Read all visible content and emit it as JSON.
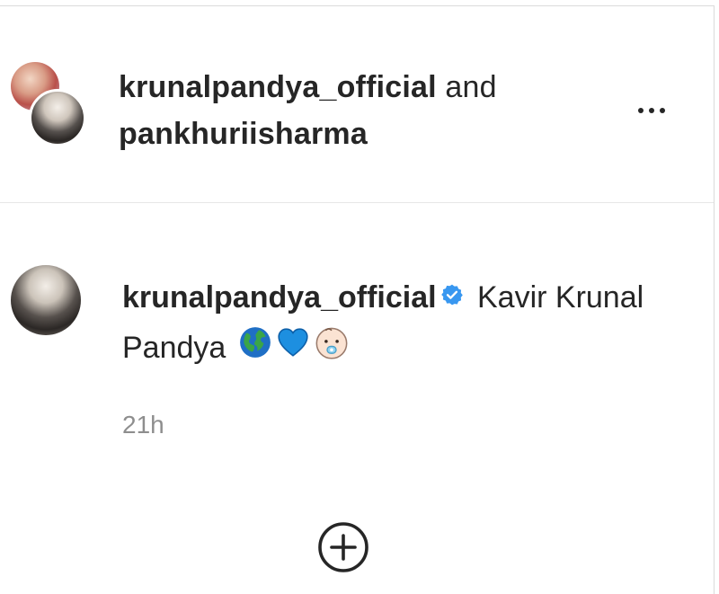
{
  "header": {
    "username_1": "krunalpandya_official",
    "conjunction": " and",
    "username_2": "pankhuriisharma",
    "more_icon": "more-horizontal-icon"
  },
  "comment": {
    "username": "krunalpandya_official",
    "verified_icon": "verified-badge-icon",
    "text": " Kavir Krunal Pandya ",
    "emojis": [
      "globe-icon",
      "blue-heart-icon",
      "baby-face-icon"
    ],
    "timestamp": "21h"
  },
  "actions": {
    "add_icon": "add-circle-icon"
  },
  "colors": {
    "text": "#262626",
    "muted": "#8e8e8e",
    "verified": "#3897f0",
    "heart": "#1d8fe0"
  }
}
